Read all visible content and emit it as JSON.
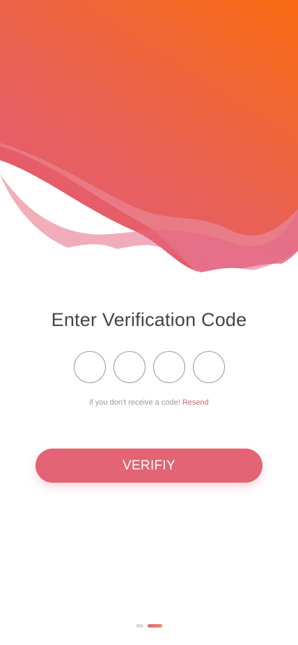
{
  "header": {
    "title": "Enter Verification Code"
  },
  "otp": {
    "digits": [
      "",
      "",
      "",
      ""
    ]
  },
  "resend": {
    "prompt": "if you don't receive a code!",
    "link_label": "Resend"
  },
  "actions": {
    "verify_label": "VERIFIY"
  },
  "pager": {
    "total": 2,
    "active_index": 1
  },
  "colors": {
    "accent": "#e36474",
    "gradient_top": "#f76a1a",
    "gradient_bottom": "#e45a78",
    "title_text": "#444444",
    "muted_text": "#9a9a9a"
  }
}
